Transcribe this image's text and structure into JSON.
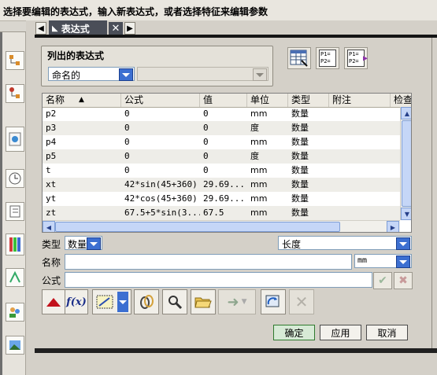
{
  "status_bar": {
    "prompt": "选择要编辑的表达式，输入新表达式，或者选择特征来编辑参数"
  },
  "tab": {
    "label": "表达式"
  },
  "listed_group": {
    "title": "列出的表达式",
    "filter_value": "命名的",
    "secondary_value": ""
  },
  "table": {
    "columns": [
      "名称",
      "公式",
      "值",
      "单位",
      "类型",
      "附注",
      "检查"
    ],
    "rows": [
      {
        "name": "p2",
        "formula": "0",
        "value": "0",
        "unit": "mm",
        "type": "数量",
        "note": ""
      },
      {
        "name": "p3",
        "formula": "0",
        "value": "0",
        "unit": "度",
        "type": "数量",
        "note": ""
      },
      {
        "name": "p4",
        "formula": "0",
        "value": "0",
        "unit": "mm",
        "type": "数量",
        "note": ""
      },
      {
        "name": "p5",
        "formula": "0",
        "value": "0",
        "unit": "度",
        "type": "数量",
        "note": ""
      },
      {
        "name": "t",
        "formula": "0",
        "value": "0",
        "unit": "mm",
        "type": "数量",
        "note": ""
      },
      {
        "name": "xt",
        "formula": "42*sin(45+360)",
        "value": "29.69...",
        "unit": "mm",
        "type": "数量",
        "note": ""
      },
      {
        "name": "yt",
        "formula": "42*cos(45+360)",
        "value": "29.69...",
        "unit": "mm",
        "type": "数量",
        "note": ""
      },
      {
        "name": "zt",
        "formula": "67.5+5*sin(3...",
        "value": "67.5",
        "unit": "mm",
        "type": "数量",
        "note": ""
      }
    ]
  },
  "form": {
    "type_label": "类型",
    "type_value": "数量",
    "dimension_value": "长度",
    "name_label": "名称",
    "name_value": "",
    "unit_value": "mm",
    "formula_label": "公式",
    "formula_value": ""
  },
  "buttons": {
    "ok": "确定",
    "apply": "应用",
    "cancel": "取消"
  },
  "icons": {
    "list_icon": "spreadsheet-icon",
    "p1p2_a": "P1=\nP2=",
    "p1p2_b": "P1=\nP2="
  }
}
